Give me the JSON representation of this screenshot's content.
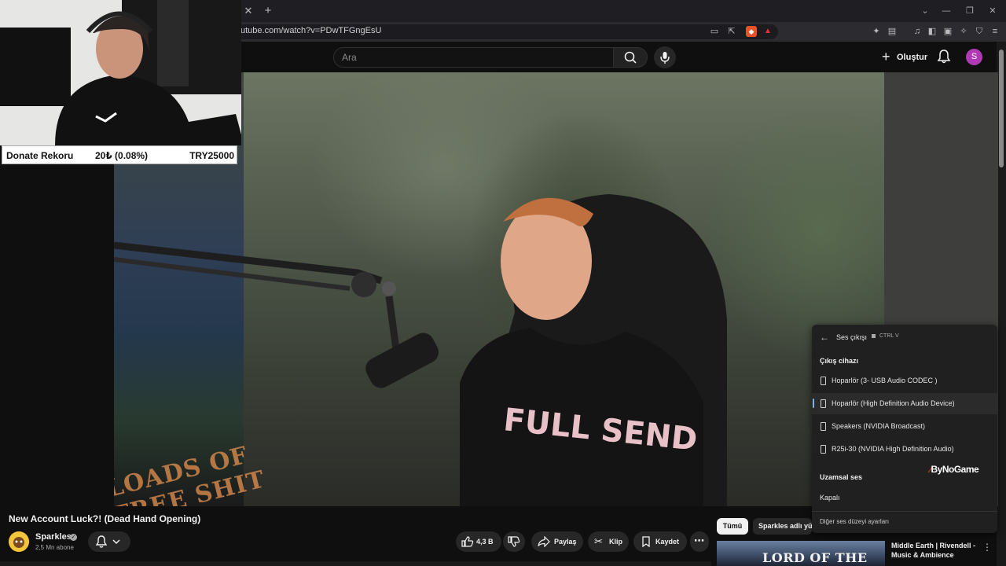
{
  "browser": {
    "url": "utube.com/watch?v=PDwTFGngEsU",
    "tab_close": "✕",
    "tab_new": "+"
  },
  "youtube": {
    "search_placeholder": "Ara",
    "create_label": "Oluştur",
    "avatar_letter": "S"
  },
  "overlay": {
    "donate_label": "Donate Rekoru",
    "donate_amount": "20₺ (0.08%)",
    "donate_goal": "TRY25000"
  },
  "audio_menu": {
    "title": "Ses çıkışı",
    "shortcut": "CTRL  V",
    "section_output": "Çıkış cihazı",
    "devices": [
      {
        "label": "Hoparlör (3- USB Audio CODEC )"
      },
      {
        "label": "Hoparlör (High Definition Audio Device)",
        "selected": true
      },
      {
        "label": "Speakers (NVIDIA Broadcast)"
      },
      {
        "label": "R25i-30 (NVIDIA High Definition Audio)"
      }
    ],
    "section_spatial": "Uzamsal ses",
    "spatial_value": "Kapalı",
    "more_settings": "Diğer ses düzeyi ayarları",
    "watermark": "ByNoGame"
  },
  "video": {
    "poster_text": "LOADS OF FREE SHIT",
    "shirt_text": "FULL SEND",
    "title": "New Account Luck?! (Dead Hand Opening)",
    "channel": "Sparkles",
    "subscribers": "2,5 Mn abone",
    "likes": "4,3 B",
    "share": "Paylaş",
    "clip": "Klip",
    "save": "Kaydet"
  },
  "sidebar": {
    "chip_all": "Tümü",
    "chip_channel": "Sparkles adlı yü",
    "rec_title": "Middle Earth | Rivendell - Music & Ambience",
    "rec_thumb_text": "LORD OF THE RINGS"
  },
  "colors": {
    "background": "#0f0f0f",
    "avatar": "#b03ab5",
    "menu_bg": "#202020",
    "menu_accent": "#7fb0e8"
  }
}
